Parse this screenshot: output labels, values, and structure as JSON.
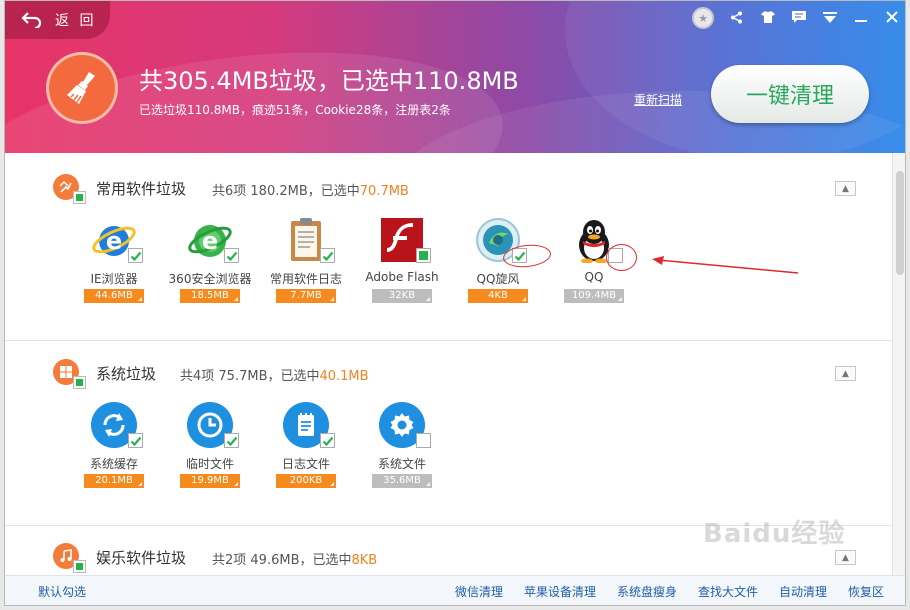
{
  "header": {
    "back_label": "返 回",
    "title": "共305.4MB垃圾，已选中110.8MB",
    "subtitle": "已选垃圾110.8MB，痕迹51条，Cookie28条，注册表2条",
    "rescan": "重新扫描",
    "clean_button": "一键清理"
  },
  "sections": [
    {
      "title": "常用软件垃圾",
      "summary_prefix": "共6项 180.2MB，已选中",
      "summary_selected": "70.7MB",
      "items": [
        {
          "label": "IE浏览器",
          "size": "44.6MB",
          "checked": true
        },
        {
          "label": "360安全浏览器",
          "size": "18.5MB",
          "checked": true
        },
        {
          "label": "常用软件日志",
          "size": "7.7MB",
          "checked": true
        },
        {
          "label": "Adobe Flash",
          "size": "32KB",
          "checked": "partial"
        },
        {
          "label": "QQ旋风",
          "size": "4KB",
          "checked": true
        },
        {
          "label": "QQ",
          "size": "109.4MB",
          "checked": false
        }
      ]
    },
    {
      "title": "系统垃圾",
      "summary_prefix": "共4项 75.7MB，已选中",
      "summary_selected": "40.1MB",
      "items": [
        {
          "label": "系统缓存",
          "size": "20.1MB",
          "checked": true
        },
        {
          "label": "临时文件",
          "size": "19.9MB",
          "checked": true
        },
        {
          "label": "日志文件",
          "size": "200KB",
          "checked": true
        },
        {
          "label": "系统文件",
          "size": "35.6MB",
          "checked": false
        }
      ]
    },
    {
      "title": "娱乐软件垃圾",
      "summary_prefix": "共2项 49.6MB，已选中",
      "summary_selected": "8KB"
    }
  ],
  "footer": {
    "default_select": "默认勾选",
    "links": [
      "微信清理",
      "苹果设备清理",
      "系统盘瘦身",
      "查找大文件",
      "自动清理",
      "恢复区"
    ]
  },
  "watermark": {
    "brand": "Baidu",
    "suffix": "经验"
  },
  "colors": {
    "accent_orange": "#f58220",
    "check_green": "#25b24a",
    "clean_text": "#27a85a"
  }
}
